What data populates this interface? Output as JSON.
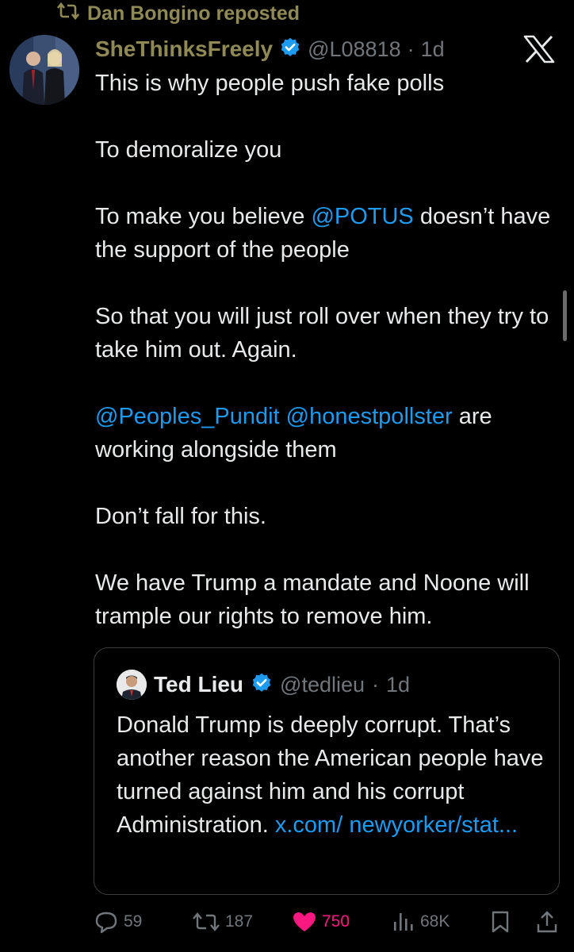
{
  "repost": {
    "icon": "repost-icon",
    "label": "Dan Bongino reposted"
  },
  "tweet": {
    "author_name": "SheThinksFreely",
    "handle": "@L08818",
    "separator": "·",
    "time": "1d",
    "paragraphs": {
      "p1": "This is why people push fake polls",
      "p2": "To demoralize you",
      "p3_before": "To make you believe ",
      "p3_mention": "@POTUS",
      "p3_after": " doesn’t have the support of the people",
      "p4": "So that you will just roll over when they try to take him out. Again.",
      "p5_mention1": "@Peoples_Pundit",
      "p5_space": " ",
      "p5_mention2": "@honestpollster",
      "p5_after": " are working alongside them",
      "p6": "Don’t fall for this.",
      "p7": "We have Trump a mandate and Noone will trample our rights to remove him."
    }
  },
  "quote": {
    "author_name": "Ted Lieu",
    "handle": "@tedlieu",
    "separator": "·",
    "time": "1d",
    "text": "Donald Trump is deeply corrupt. That’s another reason the American people have turned against him and his corrupt Administration. ",
    "link": "x.com/ newyorker/stat..."
  },
  "actions": {
    "replies": "59",
    "reposts": "187",
    "likes": "750",
    "views": "68K"
  },
  "colors": {
    "background": "#000000",
    "text": "#e7e9ea",
    "muted": "#71767b",
    "link": "#1d9bf0",
    "like": "#f91880",
    "verified": "#1d9bf0",
    "highlight_name": "#8f8a55"
  }
}
